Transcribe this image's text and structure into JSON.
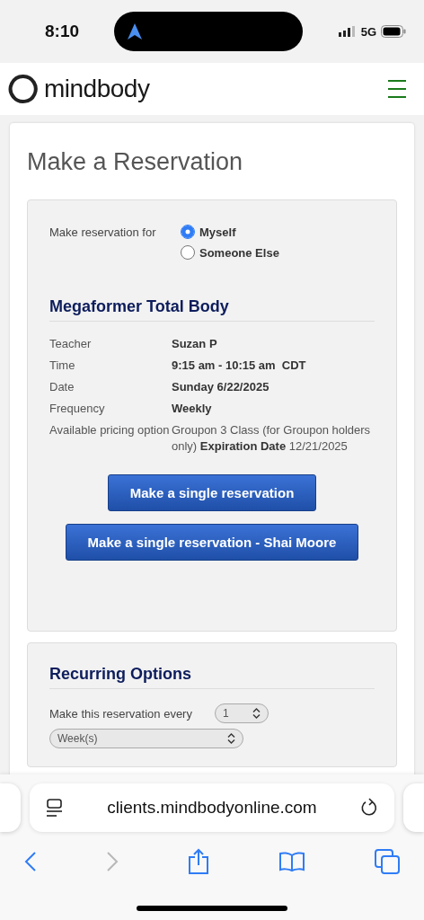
{
  "status_bar": {
    "time": "8:10",
    "network": "5G"
  },
  "header": {
    "logo": "mindbody"
  },
  "page_title": "Make a Reservation",
  "reservation_for": {
    "label": "Make reservation for",
    "options": [
      {
        "label": "Myself",
        "selected": true
      },
      {
        "label": "Someone Else",
        "selected": false
      }
    ]
  },
  "class_title": "Megaformer Total Body",
  "details": [
    {
      "label": "Teacher",
      "value": "Suzan P",
      "bold": true
    },
    {
      "label": "Time",
      "value": "9:15 am - 10:15 am  CDT",
      "bold": true
    },
    {
      "label": "Date",
      "value": "Sunday 6/22/2025",
      "bold": true
    },
    {
      "label": "Frequency",
      "value": "Weekly",
      "bold": true
    },
    {
      "label": "Available pricing option",
      "value": "Groupon 3 Class (for Groupon holders only) **Expiration Date** 12/21/2025",
      "bold": false
    }
  ],
  "buttons": [
    "Make a single reservation",
    "Make a single reservation - Shai Moore"
  ],
  "recurring": {
    "title": "Recurring Options",
    "every_label": "Make this reservation every",
    "count": "1",
    "unit": "Week(s)"
  },
  "browser": {
    "url": "clients.mindbodyonline.com"
  }
}
